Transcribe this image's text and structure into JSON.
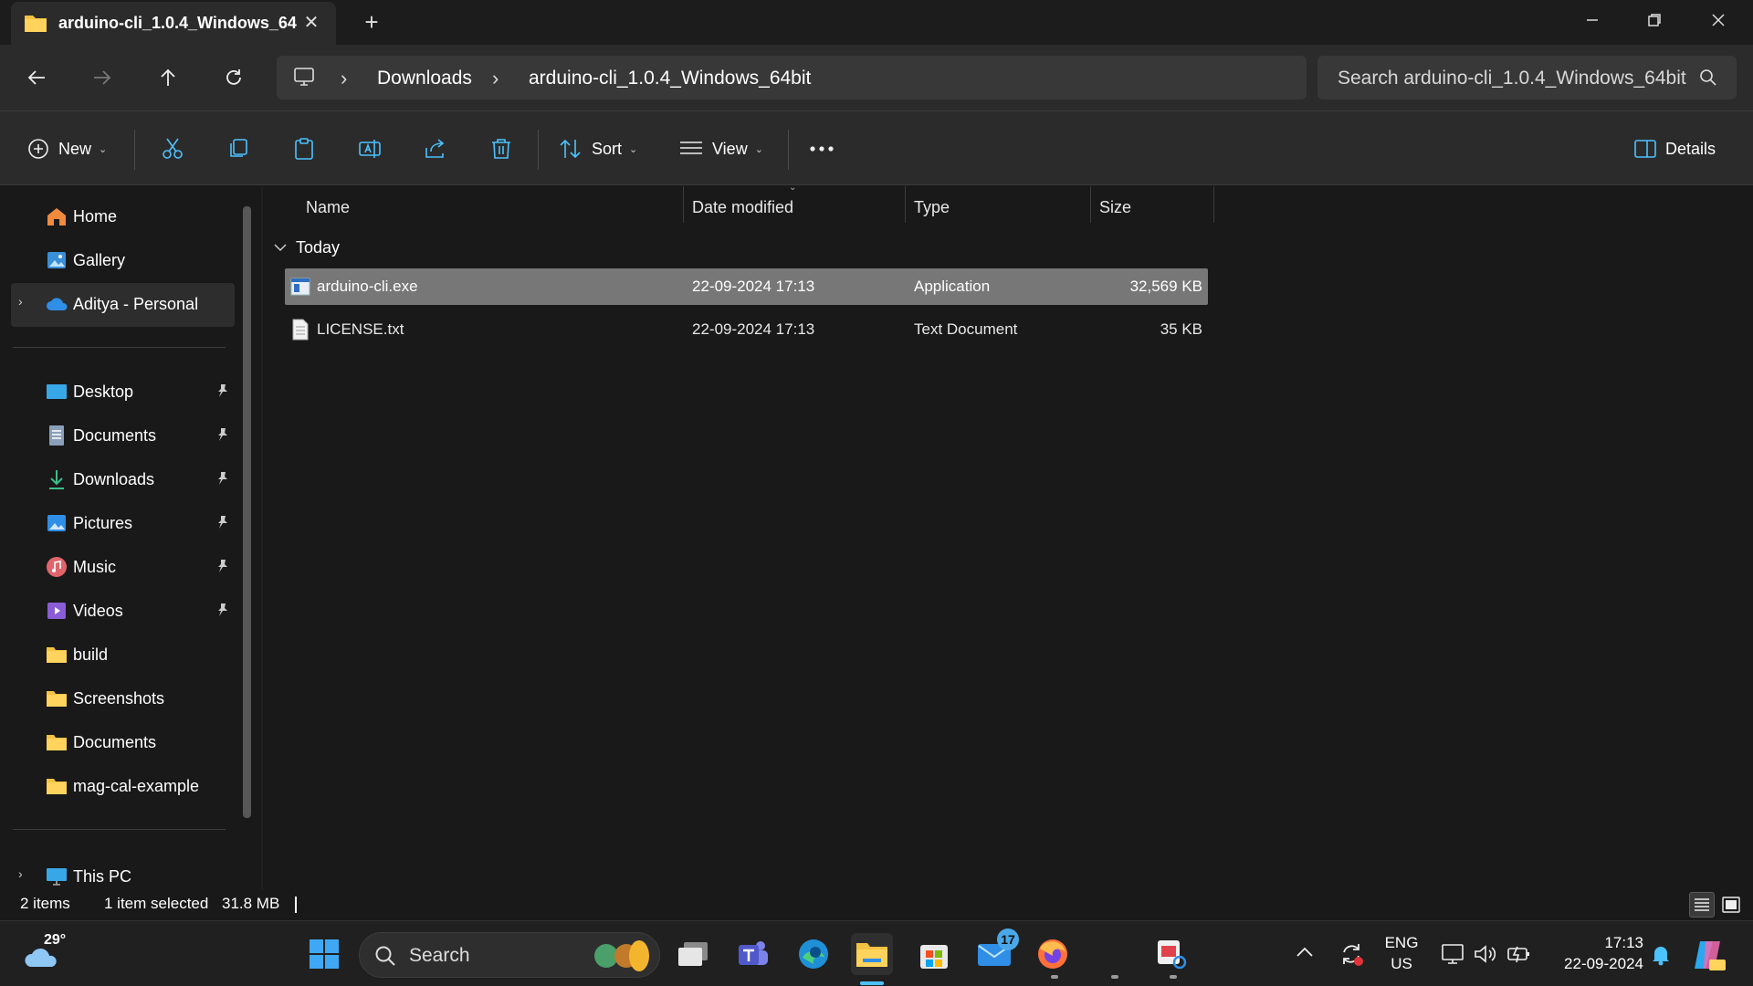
{
  "window": {
    "tab_title": "arduino-cli_1.0.4_Windows_64bit",
    "new_tab_label": "+",
    "tab_close_label": "✕"
  },
  "address": {
    "crumbs": [
      "Downloads",
      "arduino-cli_1.0.4_Windows_64bit"
    ],
    "search_placeholder": "Search arduino-cli_1.0.4_Windows_64bit"
  },
  "toolbar": {
    "new_label": "New",
    "sort_label": "Sort",
    "view_label": "View",
    "details_label": "Details"
  },
  "sidebar": {
    "quick": [
      {
        "label": "Home",
        "icon": "home-icon"
      },
      {
        "label": "Gallery",
        "icon": "gallery-icon"
      },
      {
        "label": "Aditya - Personal",
        "icon": "onedrive-icon"
      }
    ],
    "pinned": [
      {
        "label": "Desktop",
        "icon": "desktop-icon",
        "pinned": true
      },
      {
        "label": "Documents",
        "icon": "documents-icon",
        "pinned": true
      },
      {
        "label": "Downloads",
        "icon": "downloads-icon",
        "pinned": true
      },
      {
        "label": "Pictures",
        "icon": "pictures-icon",
        "pinned": true
      },
      {
        "label": "Music",
        "icon": "music-icon",
        "pinned": true
      },
      {
        "label": "Videos",
        "icon": "videos-icon",
        "pinned": true
      },
      {
        "label": "build",
        "icon": "folder-icon",
        "pinned": false
      },
      {
        "label": "Screenshots",
        "icon": "folder-icon",
        "pinned": false
      },
      {
        "label": "Documents",
        "icon": "folder-icon",
        "pinned": false
      },
      {
        "label": "mag-cal-example",
        "icon": "folder-icon",
        "pinned": false
      }
    ],
    "this_pc": "This PC"
  },
  "columns": {
    "name": "Name",
    "date": "Date modified",
    "type": "Type",
    "size": "Size"
  },
  "group": {
    "label": "Today"
  },
  "files": [
    {
      "name": "arduino-cli.exe",
      "date": "22-09-2024 17:13",
      "type": "Application",
      "size": "32,569 KB",
      "selected": true,
      "icon": "application-icon"
    },
    {
      "name": "LICENSE.txt",
      "date": "22-09-2024 17:13",
      "type": "Text Document",
      "size": "35 KB",
      "selected": false,
      "icon": "text-document-icon"
    }
  ],
  "status": {
    "items": "2 items",
    "selected": "1 item selected",
    "selected_size": "31.8 MB"
  },
  "taskbar": {
    "temperature": "29°",
    "search_label": "Search",
    "mail_badge": "17",
    "language_line1": "ENG",
    "language_line2": "US",
    "time": "17:13",
    "date": "22-09-2024"
  },
  "colors": {
    "accent": "#4cc2ff",
    "folder": "#f5c242",
    "selected_row": "#777777"
  }
}
